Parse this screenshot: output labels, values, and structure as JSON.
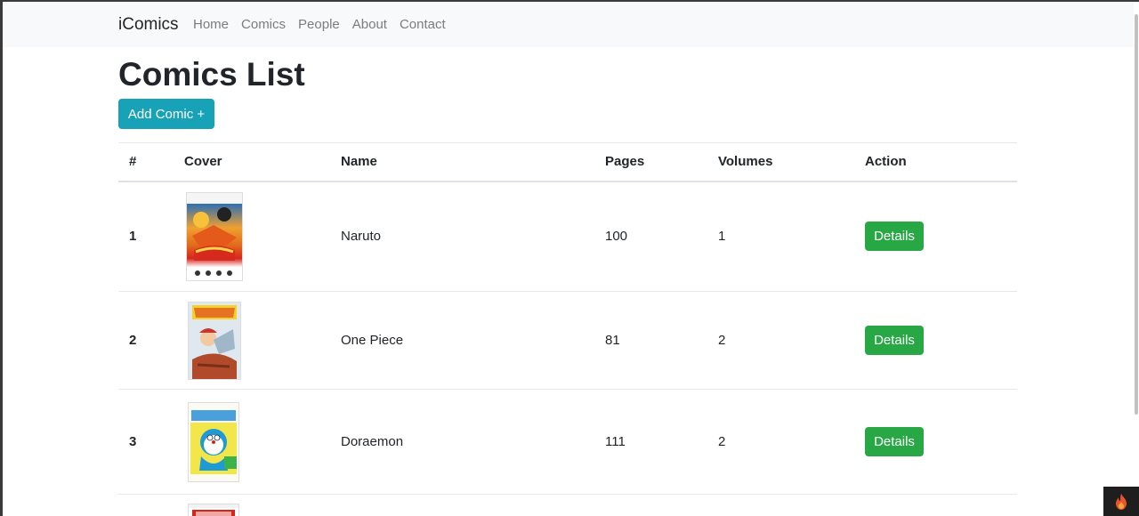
{
  "navbar": {
    "brand": "iComics",
    "links": [
      "Home",
      "Comics",
      "People",
      "About",
      "Contact"
    ]
  },
  "main": {
    "title": "Comics List",
    "add_button": "Add Comic +",
    "table": {
      "headers": [
        "#",
        "Cover",
        "Name",
        "Pages",
        "Volumes",
        "Action"
      ],
      "rows": [
        {
          "num": "1",
          "cover": "naruto-cover",
          "name": "Naruto",
          "pages": "100",
          "volumes": "1",
          "action": "Details"
        },
        {
          "num": "2",
          "cover": "one-piece-cover",
          "name": "One Piece",
          "pages": "81",
          "volumes": "2",
          "action": "Details"
        },
        {
          "num": "3",
          "cover": "doraemon-cover",
          "name": "Doraemon",
          "pages": "111",
          "volumes": "2",
          "action": "Details"
        }
      ]
    }
  },
  "colors": {
    "navbar_bg": "#f8f9fa",
    "add_button": "#17a2b8",
    "details_button": "#28a745"
  },
  "icons": {
    "corner_badge": "flame-icon"
  }
}
